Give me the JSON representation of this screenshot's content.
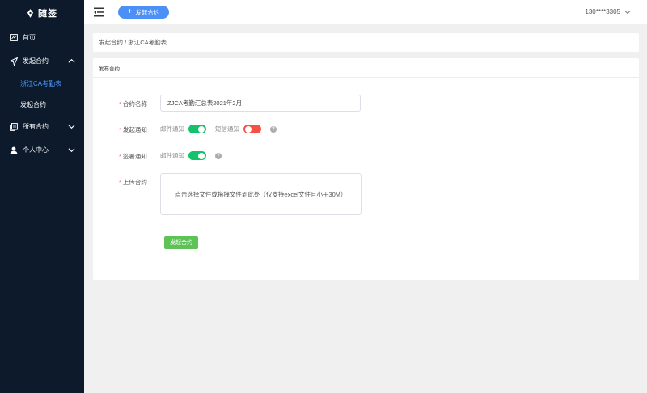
{
  "app": {
    "logo_text": "随签"
  },
  "sidebar": {
    "items": [
      {
        "label": "首页"
      },
      {
        "label": "发起合约"
      },
      {
        "label": "浙江CA考勤表"
      },
      {
        "label": "发起合约"
      },
      {
        "label": "所有合约"
      },
      {
        "label": "个人中心"
      }
    ],
    "active_color": "#4a9bff",
    "background": "#0c1a2c"
  },
  "header": {
    "new_button_label": "发起合约",
    "user": "130****3305"
  },
  "breadcrumb": {
    "text": "发起合约 / 浙江CA考勤表"
  },
  "card": {
    "title": "发布合约",
    "fields": {
      "name_label": "合约名称",
      "name_value": "ZJCA考勤汇总表2021年2月",
      "notify_label": "发起通知",
      "email_notify": "邮件通知",
      "email_notify_on": true,
      "sms_notify": "短信通知",
      "sms_notify_on": false,
      "sign_label": "签署通知",
      "sign_email_notify": "邮件通知",
      "sign_email_notify_on": true,
      "upload_label": "上传合约",
      "upload_hint": "点击选择文件或拖拽文件到此处（仅支持excel文件且小于30M）"
    },
    "submit_label": "发起合约"
  },
  "colors": {
    "primary": "#4b8ff7",
    "switch_on": "#13c26b",
    "switch_off": "#f55245",
    "submit": "#5ec257",
    "required": "#f56c6c"
  }
}
